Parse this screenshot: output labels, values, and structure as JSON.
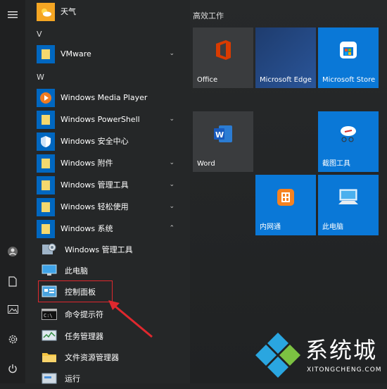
{
  "rail": {
    "menu_icon": "hamburger-menu-icon",
    "user_icon": "user-icon",
    "documents_icon": "document-icon",
    "pictures_icon": "picture-icon",
    "settings_icon": "gear-icon",
    "power_icon": "power-icon"
  },
  "apps": {
    "weather": "天气",
    "letter_v": "V",
    "vmware": "VMware",
    "letter_w": "W",
    "wmp": "Windows Media Player",
    "powershell": "Windows PowerShell",
    "security": "Windows 安全中心",
    "accessories": "Windows 附件",
    "admin_tools": "Windows 管理工具",
    "ease_of_access": "Windows 轻松使用",
    "system": "Windows 系统",
    "system_children": {
      "admin_tools": "Windows 管理工具",
      "this_pc": "此电脑",
      "control_panel": "控制面板",
      "cmd": "命令提示符",
      "task_manager": "任务管理器",
      "explorer": "文件资源管理器",
      "run": "运行"
    }
  },
  "tiles": {
    "group_title": "高效工作",
    "office": "Office",
    "edge": "Microsoft Edge",
    "store": "Microsoft Store",
    "word": "Word",
    "snipping": "截图工具",
    "intranet": "内网通",
    "this_pc": "此电脑"
  },
  "watermark": {
    "text": "系统城",
    "url": "XITONGCHENG.COM"
  },
  "colors": {
    "accent": "#0067c0",
    "tile_blue": "#0a78d7",
    "highlight": "#e0282e"
  }
}
